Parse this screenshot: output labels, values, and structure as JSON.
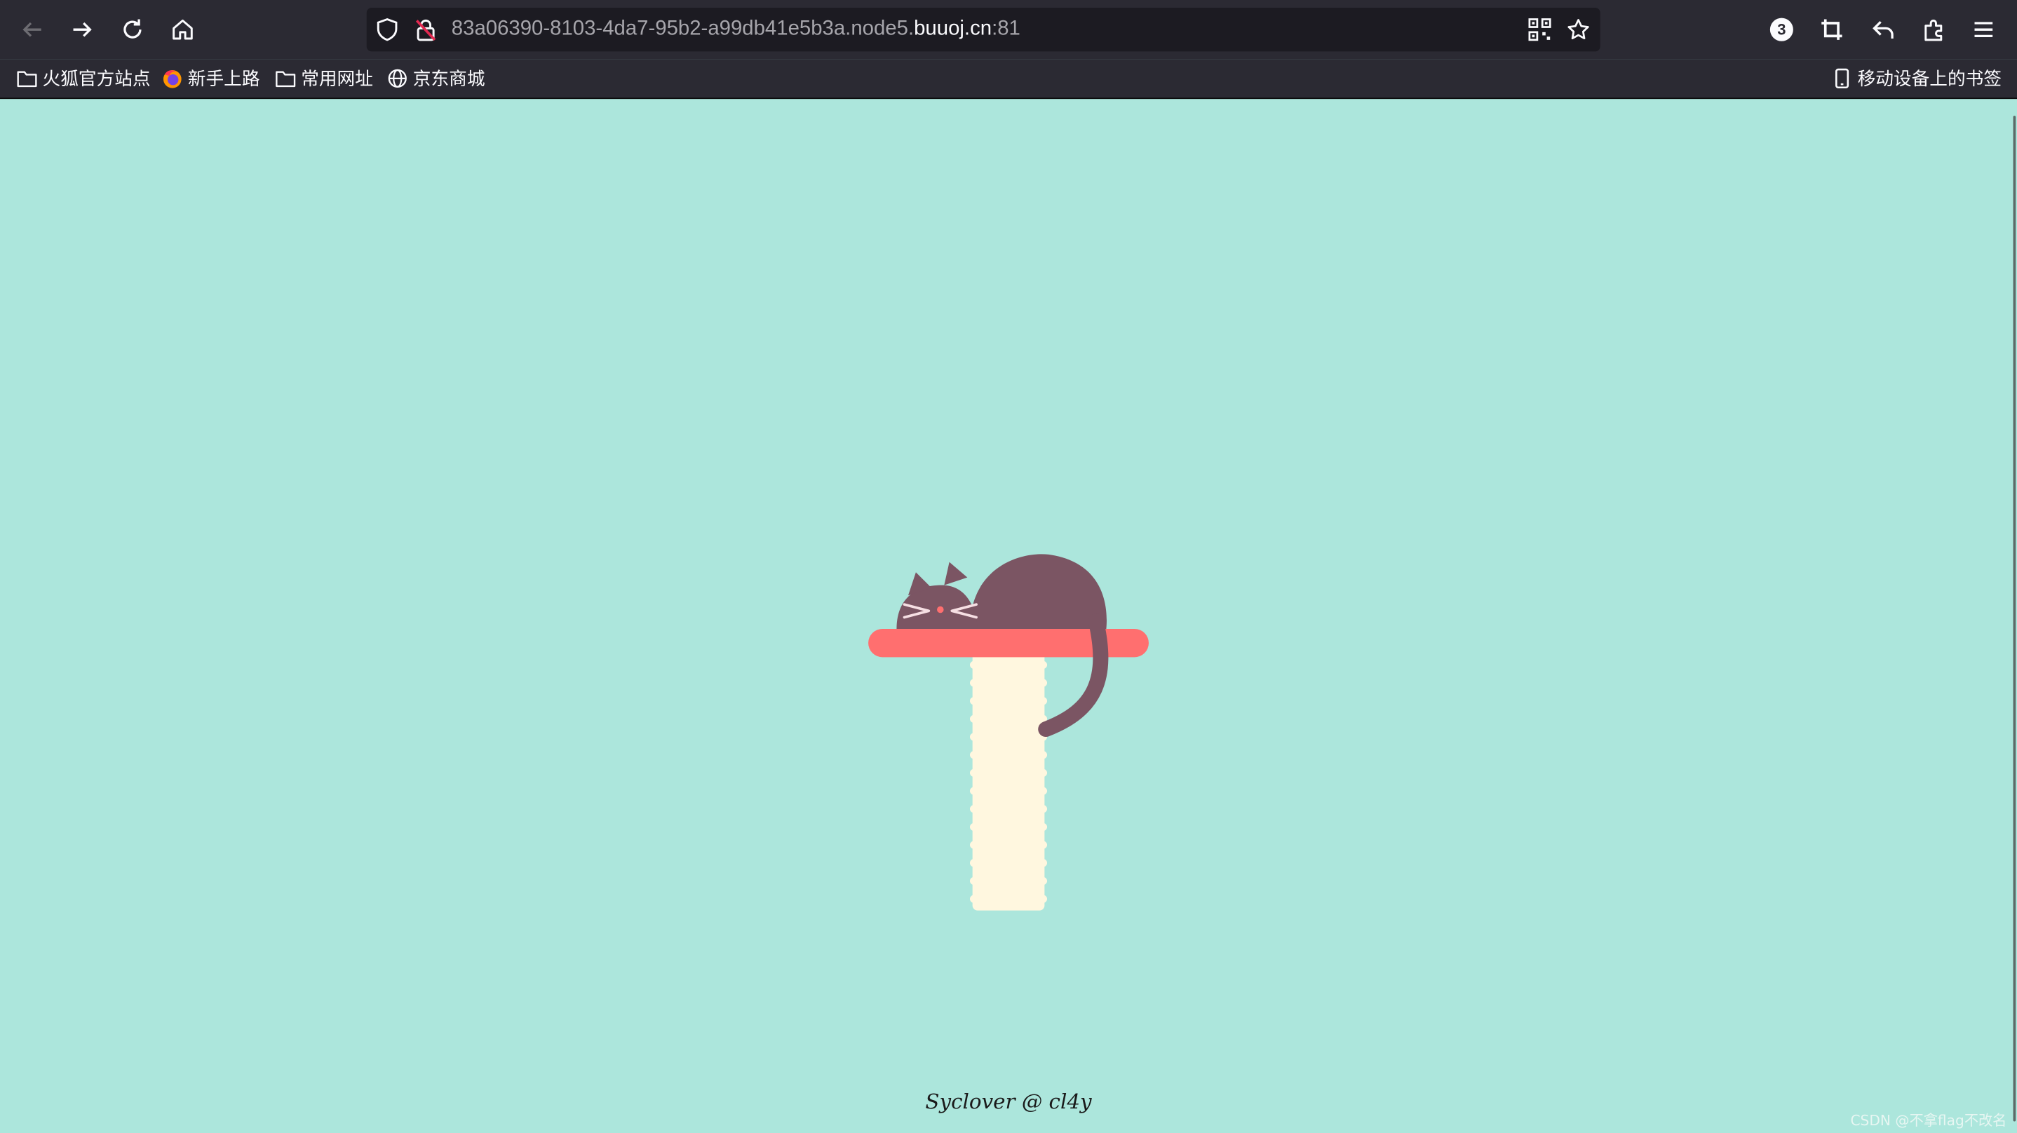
{
  "browser": {
    "url_path": "83a06390-8103-4da7-95b2-a99db41e5b3a.node5.",
    "url_domain": "buuoj.cn",
    "url_port": ":81",
    "extensions_badge": "3"
  },
  "bookmarks": {
    "items": [
      {
        "label": "火狐官方站点",
        "icon": "folder-icon"
      },
      {
        "label": "新手上路",
        "icon": "firefox-icon"
      },
      {
        "label": "常用网址",
        "icon": "folder-icon"
      },
      {
        "label": "京东商城",
        "icon": "globe-icon"
      }
    ],
    "mobile_label": "移动设备上的书签"
  },
  "page": {
    "footer": "Syclover @ cl4y",
    "watermark": "CSDN @不拿flag不改名"
  },
  "colors": {
    "background": "#ace6dc",
    "cat": "#7b5563",
    "perch": "#ff6f6f",
    "post": "#fff7df",
    "chrome": "#2b2a33"
  }
}
